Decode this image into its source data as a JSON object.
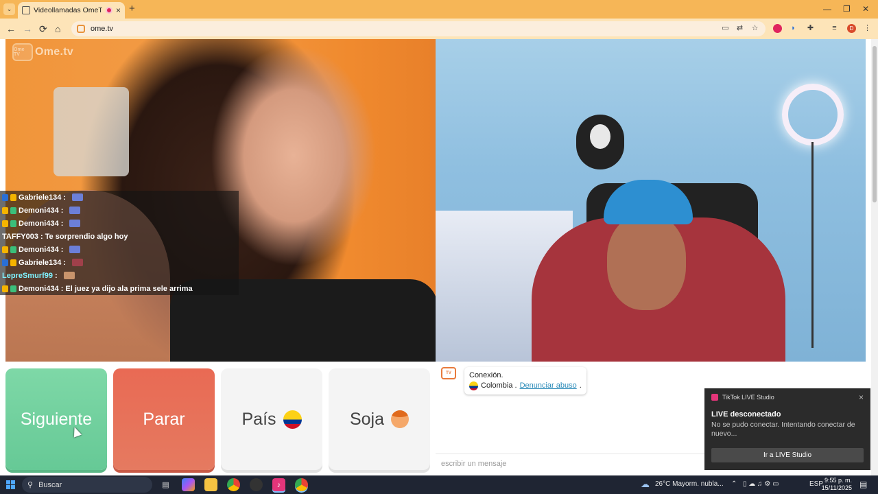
{
  "browser": {
    "tab": {
      "title": "Videollamadas OmeTV — A",
      "close": "×"
    },
    "new_tab": "+",
    "window": {
      "minimize": "—",
      "restore": "❐",
      "close": "✕"
    },
    "nav": {
      "back": "←",
      "forward": "→",
      "reload": "⟳",
      "home": "⌂"
    },
    "url": "ome.tv",
    "profile_initial": "D"
  },
  "site": {
    "logo_badge": "Ome TV",
    "logo_text": "Ome.tv"
  },
  "chat": {
    "lines": [
      {
        "user": "Gabriele134",
        "sep": " :",
        "text": "",
        "badges": [
          "blue",
          "lvl"
        ],
        "gift": "blue"
      },
      {
        "user": "Demoni434",
        "sep": " :",
        "text": "",
        "badges": [
          "lvl",
          "green"
        ],
        "gift": "blue"
      },
      {
        "user": "Demoni434",
        "sep": " :",
        "text": "",
        "badges": [
          "lvl",
          "green"
        ],
        "gift": "blue"
      },
      {
        "user": "TAFFY003",
        "sep": " :",
        "text": " Te sorprendio algo hoy",
        "badges": [],
        "gift": ""
      },
      {
        "user": "Demoni434",
        "sep": " :",
        "text": "",
        "badges": [
          "lvl",
          "green"
        ],
        "gift": "blue"
      },
      {
        "user": "Gabriele134",
        "sep": " :",
        "text": "",
        "badges": [
          "blue",
          "lvl"
        ],
        "gift": "red"
      },
      {
        "user": "LepreSmurf99",
        "sep": " :",
        "text": "",
        "badges": [],
        "gift": "tan"
      },
      {
        "user": "Demoni434",
        "sep": " :",
        "text": " El juez ya dijo ala prima sele arrima",
        "badges": [
          "lvl",
          "green"
        ],
        "gift": ""
      }
    ]
  },
  "controls": {
    "next": "Siguiente",
    "stop": "Parar",
    "country": "País",
    "gender": "Soja"
  },
  "conversation": {
    "status": "Conexión.",
    "country": "Colombia .",
    "report": "Denunciar abuso",
    "report_suffix": ".",
    "input_placeholder": "escribir un mensaje"
  },
  "toast": {
    "app": "TikTok LIVE Studio",
    "title": "LIVE desconectado",
    "body": "No se pudo conectar. Intentando conectar de nuevo...",
    "action": "Ir a LIVE Studio",
    "close": "×"
  },
  "taskbar": {
    "search": "Buscar",
    "weather": "26°C  Mayorm. nubla...",
    "lang": "ESP",
    "time": "9:55 p. m.",
    "date": "15/11/2025"
  },
  "colors": {
    "next": "#6fd09d",
    "stop": "#e8705a",
    "chrome_frame": "#f6b657"
  }
}
